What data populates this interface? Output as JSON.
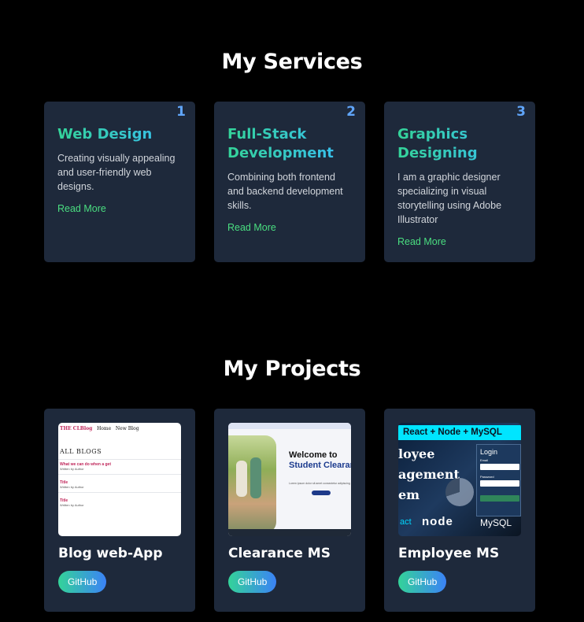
{
  "services": {
    "title": "My Services",
    "cards": [
      {
        "num": "1",
        "title": "Web Design",
        "desc": "Creating visually appealing and user-friendly web designs.",
        "link": "Read More"
      },
      {
        "num": "2",
        "title": "Full-Stack Development",
        "desc": "Combining both frontend and backend development skills.",
        "link": "Read More"
      },
      {
        "num": "3",
        "title": "Graphics Designing",
        "desc": "I am a graphic designer specializing in visual storytelling using Adobe Illustrator",
        "link": "Read More"
      }
    ]
  },
  "projects": {
    "title": "My Projects",
    "cards": [
      {
        "title": "Blog web-App",
        "button": "GitHub"
      },
      {
        "title": "Clearance MS",
        "button": "GitHub"
      },
      {
        "title": "Employee MS",
        "button": "GitHub"
      }
    ],
    "thumb_blog": {
      "brand": "THE CLBlog",
      "nav": [
        "Home",
        "New Blog"
      ],
      "heading": "ALL BLOGS",
      "items": [
        "What we can do when a get",
        "Title",
        "Title"
      ]
    },
    "thumb_clearance": {
      "welcome": "Welcome to",
      "system": "Student Clearance System"
    },
    "thumb_employee": {
      "banner": "React + Node + MySQL",
      "words": [
        "loyee",
        "agement",
        "em"
      ],
      "login": "Login",
      "react": "act",
      "node": "node",
      "mysql": "MySQL"
    }
  },
  "colors": {
    "background": "#000000",
    "card": "#1e293b",
    "number": "#60a5fa",
    "link": "#4ade80",
    "gradient_start": "#34d399",
    "gradient_end": "#3b82f6"
  }
}
